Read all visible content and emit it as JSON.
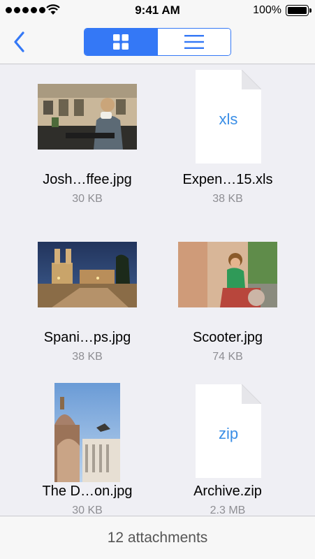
{
  "status_bar": {
    "time": "9:41 AM",
    "battery": "100%"
  },
  "nav": {
    "back_icon": "chevron-left-icon",
    "view_modes": [
      {
        "name": "grid",
        "icon": "grid-icon",
        "selected": true
      },
      {
        "name": "list",
        "icon": "list-icon",
        "selected": false
      }
    ]
  },
  "attachments": [
    {
      "name": "Josh…ffee.jpg",
      "size": "30 KB",
      "kind": "photo"
    },
    {
      "name": "Expen…15.xls",
      "size": "38 KB",
      "kind": "document",
      "ext": "xls"
    },
    {
      "name": "Spani…ps.jpg",
      "size": "38 KB",
      "kind": "photo"
    },
    {
      "name": "Scooter.jpg",
      "size": "74 KB",
      "kind": "photo"
    },
    {
      "name": "The D…on.jpg",
      "size": "30 KB",
      "kind": "photo"
    },
    {
      "name": "Archive.zip",
      "size": "2.3 MB",
      "kind": "document",
      "ext": "zip"
    }
  ],
  "footer": {
    "label": "12 attachments"
  },
  "colors": {
    "accent": "#3478f6",
    "background": "#efeff4",
    "secondary_text": "#8e8e93"
  }
}
